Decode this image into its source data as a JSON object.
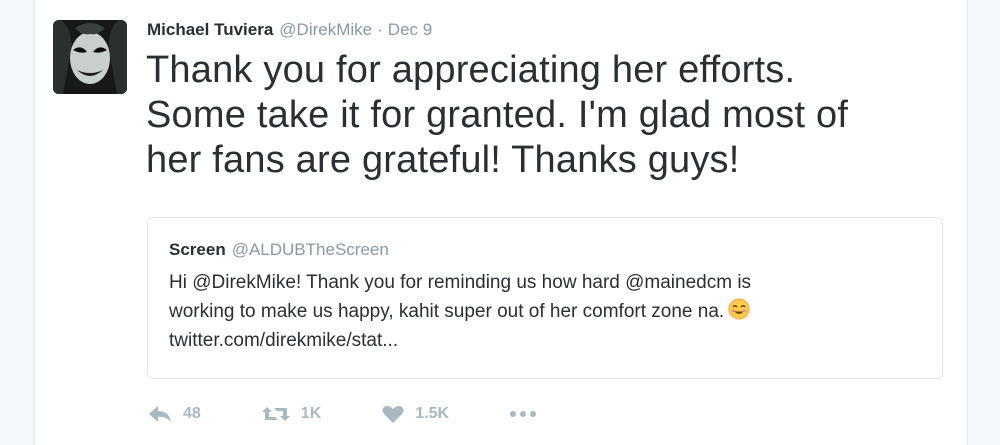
{
  "tweet": {
    "author_name": "Michael Tuviera",
    "author_handle": "@DirekMike",
    "separator": "·",
    "date": "Dec 9",
    "text_lines": [
      "Thank you for appreciating her efforts.",
      "Some take it for granted. I'm glad most of",
      "her fans are grateful! Thanks guys!"
    ]
  },
  "quoted": {
    "author_name": "Screen",
    "author_handle": "@ALDUBTheScreen",
    "text_lines": [
      "Hi @DirekMike! Thank you for reminding us how hard @mainedcm is",
      "working to make us happy, kahit super out of her comfort zone na.",
      "twitter.com/direkmike/stat..."
    ],
    "emoji_icon": "smiling-face-emoji"
  },
  "actions": {
    "reply_count": "48",
    "retweet_count": "1K",
    "like_count": "1.5K"
  },
  "colors": {
    "text": "#292f33",
    "muted": "#8899a6",
    "action_icon": "#aab8c2",
    "border": "#e1e8ed"
  }
}
